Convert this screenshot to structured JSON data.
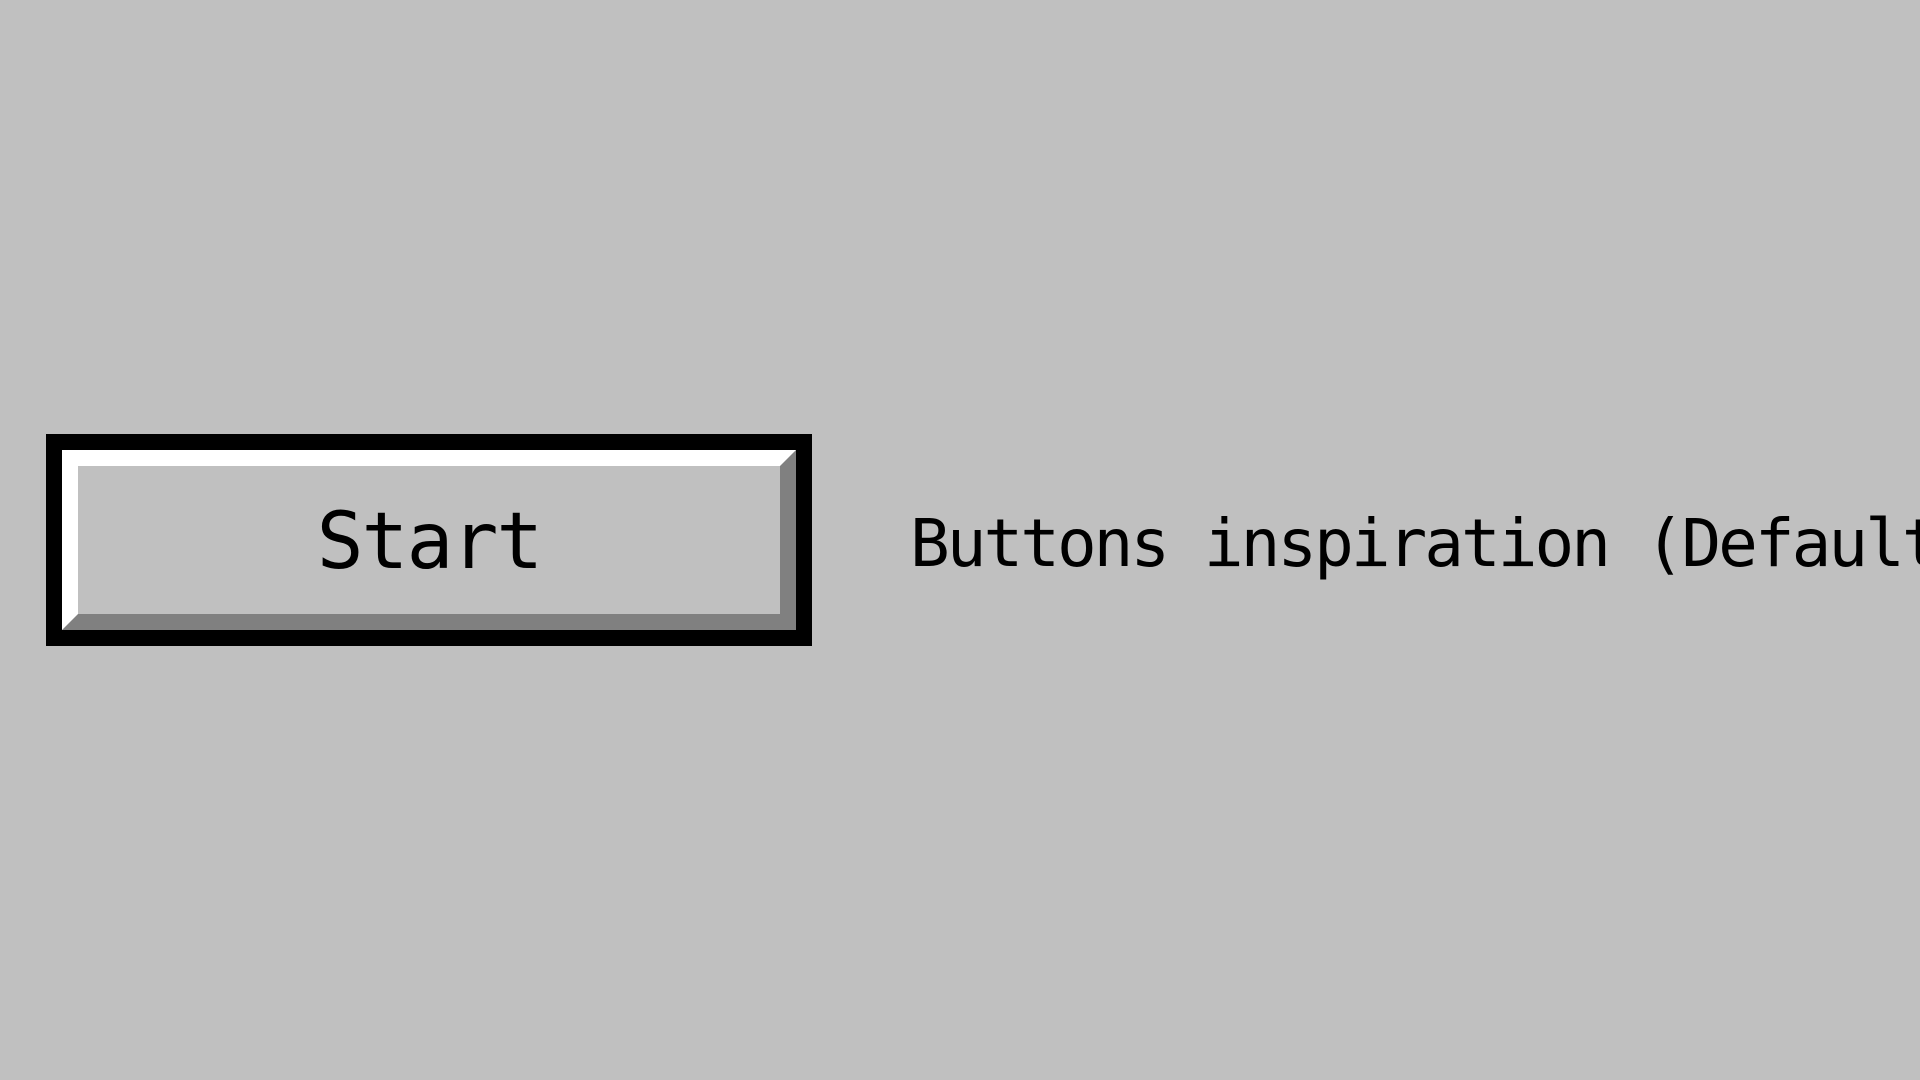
{
  "button": {
    "label": "Start"
  },
  "caption": {
    "text": "Buttons inspiration (Default)"
  },
  "colors": {
    "background": "#c0c0c0",
    "border": "#000000",
    "highlight": "#ffffff",
    "shadow": "#808080",
    "text": "#000000"
  }
}
